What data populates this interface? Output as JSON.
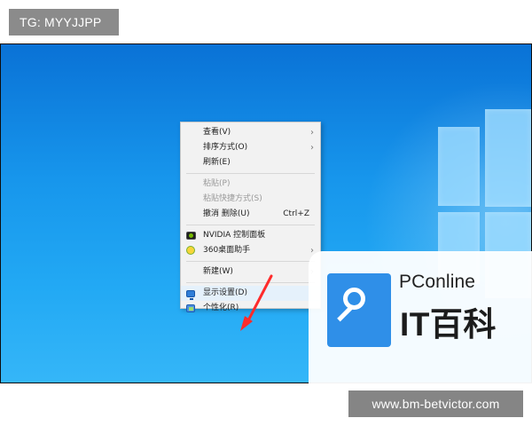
{
  "overlay": {
    "tg_label": "TG: MYYJJPP",
    "url_label": "www.bm-betvictor.com"
  },
  "desktop": {
    "context_menu": {
      "items": [
        {
          "label": "查看(V)",
          "state": "enabled",
          "has_submenu": true
        },
        {
          "label": "排序方式(O)",
          "state": "enabled",
          "has_submenu": true
        },
        {
          "label": "刷新(E)",
          "state": "enabled",
          "has_submenu": false
        },
        {
          "label": "粘贴(P)",
          "state": "disabled",
          "has_submenu": false
        },
        {
          "label": "粘贴快捷方式(S)",
          "state": "disabled",
          "has_submenu": false
        },
        {
          "label": "撤消 删除(U)",
          "shortcut": "Ctrl+Z",
          "state": "enabled",
          "has_submenu": false
        },
        {
          "label": "NVIDIA 控制面板",
          "icon": "nvidia-icon",
          "state": "enabled",
          "has_submenu": false
        },
        {
          "label": "360桌面助手",
          "icon": "360-desktop-assistant-icon",
          "state": "enabled",
          "has_submenu": true
        },
        {
          "label": "新建(W)",
          "state": "enabled",
          "has_submenu": true
        },
        {
          "label": "显示设置(D)",
          "icon": "display-settings-icon",
          "state": "highlighted",
          "has_submenu": false
        },
        {
          "label": "个性化(R)",
          "icon": "personalize-icon",
          "state": "enabled",
          "has_submenu": false
        }
      ]
    }
  },
  "watermark": {
    "brand": "PConline",
    "title": "IT百科"
  },
  "colors": {
    "desktop_blue": "#1c8ff0",
    "menu_background": "#f2f2f2",
    "arrow_red": "#ff2b2b",
    "watermark_blue": "#2f8fe8"
  },
  "icons": [
    "chevron-right-icon",
    "nvidia-icon",
    "360-desktop-assistant-icon",
    "display-settings-icon",
    "personalize-icon",
    "red-pointer-arrow-icon",
    "magnifier-logo-icon"
  ]
}
